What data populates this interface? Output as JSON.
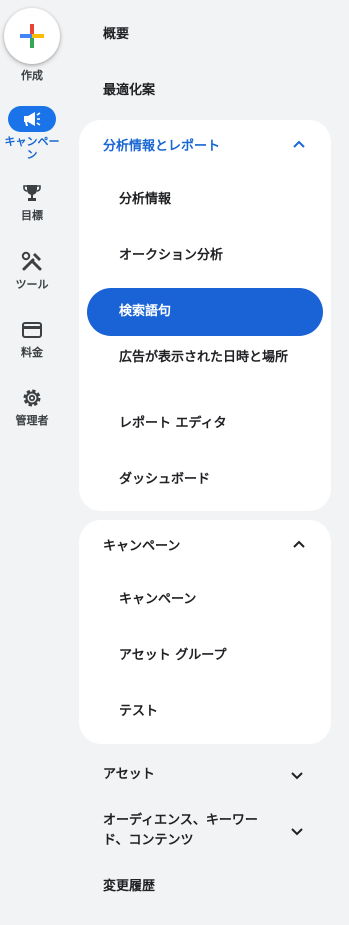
{
  "rail": {
    "create_label": "作成",
    "items": [
      {
        "label": "キャンペーン",
        "icon": "megaphone-icon",
        "active": true
      },
      {
        "label": "目標",
        "icon": "trophy-icon",
        "active": false
      },
      {
        "label": "ツール",
        "icon": "tools-icon",
        "active": false
      },
      {
        "label": "料金",
        "icon": "credit-card-icon",
        "active": false
      },
      {
        "label": "管理者",
        "icon": "gear-icon",
        "active": false
      }
    ]
  },
  "nav": {
    "overview": "概要",
    "recommendations": "最適化案",
    "insights_section": {
      "title": "分析情報とレポート",
      "items": [
        "分析情報",
        "オークション分析",
        "検索語句",
        "広告が表示された日時と場所",
        "レポート エディタ",
        "ダッシュボード"
      ],
      "selected": "検索語句"
    },
    "campaigns_section": {
      "title": "キャンペーン",
      "items": [
        "キャンペーン",
        "アセット グループ",
        "テスト"
      ]
    },
    "assets": "アセット",
    "audiences": "オーディエンス、キーワード、コンテンツ",
    "change_history": "変更履歴"
  },
  "colors": {
    "accent": "#1a73e8",
    "selected": "#1a63d6",
    "background": "#f1f3f4"
  }
}
